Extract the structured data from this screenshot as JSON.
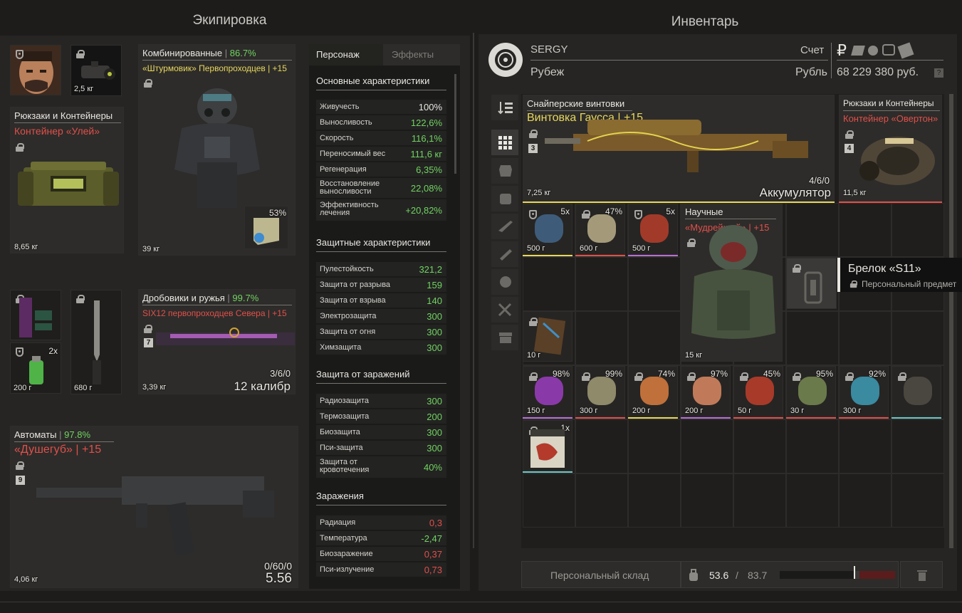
{
  "equipment": {
    "title": "Экипировка",
    "binocular_weight": "2,5 кг",
    "backpack": {
      "category": "Рюкзаки и Контейнеры",
      "name": "Контейнер «Улей»",
      "weight": "8,65 кг"
    },
    "armor": {
      "category": "Комбинированные",
      "durability": "86.7%",
      "name": "«Штурмовик» Первопроходцев | +15",
      "plate_pct": "53%",
      "weight": "39 кг"
    },
    "grenade": {
      "count": "2x",
      "weight": "200 г"
    },
    "knife": {
      "weight": "680 г"
    },
    "shotgun": {
      "category": "Дробовики и ружья",
      "durability": "99.7%",
      "name": "SIX12 первопроходцев Севера | +15",
      "badge": "7",
      "ammo": "3/6/0",
      "caliber": "12 калибр",
      "weight": "3,39 кг"
    },
    "rifle": {
      "category": "Автоматы",
      "durability": "97.8%",
      "name": "«Душегуб» | +15",
      "badge": "9",
      "ammo": "0/60/0",
      "caliber": "5.56",
      "weight": "4,06 кг"
    }
  },
  "stats": {
    "tabs": [
      "Персонаж",
      "Эффекты"
    ],
    "sections": [
      {
        "title": "Основные характеристики",
        "rows": [
          {
            "label": "Живучесть",
            "value": "100%",
            "color": "#e9e7e2"
          },
          {
            "label": "Выносливость",
            "value": "122,6%",
            "color": "#71d361"
          },
          {
            "label": "Скорость",
            "value": "116,1%",
            "color": "#71d361"
          },
          {
            "label": "Переносимый вес",
            "value": "111,6 кг",
            "color": "#71d361"
          },
          {
            "label": "Регенерация",
            "value": "6,35%",
            "color": "#71d361"
          },
          {
            "label": "Восстановление выносливости",
            "value": "22,08%",
            "color": "#71d361"
          },
          {
            "label": "Эффективность лечения",
            "value": "+20,82%",
            "color": "#71d361"
          }
        ]
      },
      {
        "title": "Защитные характеристики",
        "rows": [
          {
            "label": "Пулестойкость",
            "value": "321,2",
            "color": "#71d361"
          },
          {
            "label": "Защита от разрыва",
            "value": "159",
            "color": "#71d361"
          },
          {
            "label": "Защита от взрыва",
            "value": "140",
            "color": "#71d361"
          },
          {
            "label": "Электрозащита",
            "value": "300",
            "color": "#71d361"
          },
          {
            "label": "Защита от огня",
            "value": "300",
            "color": "#71d361"
          },
          {
            "label": "Химзащита",
            "value": "300",
            "color": "#71d361"
          }
        ]
      },
      {
        "title": "Защита от заражений",
        "rows": [
          {
            "label": "Радиозащита",
            "value": "300",
            "color": "#71d361"
          },
          {
            "label": "Термозащита",
            "value": "200",
            "color": "#71d361"
          },
          {
            "label": "Биозащита",
            "value": "300",
            "color": "#71d361"
          },
          {
            "label": "Пси-защита",
            "value": "300",
            "color": "#71d361"
          },
          {
            "label": "Защита от кровотечения",
            "value": "40%",
            "color": "#71d361"
          }
        ]
      },
      {
        "title": "Заражения",
        "rows": [
          {
            "label": "Радиация",
            "value": "0,3",
            "color": "#e0504b"
          },
          {
            "label": "Температура",
            "value": "-2,47",
            "color": "#71d361"
          },
          {
            "label": "Биозаражение",
            "value": "0,37",
            "color": "#e0504b"
          },
          {
            "label": "Пси-излучение",
            "value": "0,73",
            "color": "#e0504b"
          }
        ]
      }
    ]
  },
  "inventory": {
    "title": "Инвентарь",
    "player": "SERGY",
    "server": "Рубеж",
    "account_label": "Счет",
    "currency_label": "Рубль",
    "balance": "68 229 380 руб.",
    "help": "?",
    "sniper": {
      "category": "Снайперские винтовки",
      "name": "Винтовка Гаусса | +15",
      "badge": "3",
      "ammo": "4/6/0",
      "caliber": "Аккумулятор",
      "weight": "7,25 кг"
    },
    "container": {
      "category": "Рюкзаки и Контейнеры",
      "name": "Контейнер «Овертон»",
      "badge": "4",
      "weight": "11,5 кг"
    },
    "sci_armor": {
      "category": "Научные",
      "name": "«Мудрейший» | +15",
      "weight": "15 кг"
    },
    "items_row1": [
      {
        "count": "5x",
        "weight": "500 г",
        "line": "#e8d75c"
      },
      {
        "pct": "47%",
        "weight": "600 г",
        "line": "#e0504b"
      },
      {
        "count": "5x",
        "weight": "500 г",
        "line": "#b86fd6"
      }
    ],
    "item_map": {
      "weight": "10 г"
    },
    "items_row4": [
      {
        "pct": "98%",
        "weight": "150 г",
        "line": "#b86fd6"
      },
      {
        "pct": "99%",
        "weight": "300 г",
        "line": "#e0504b"
      },
      {
        "pct": "74%",
        "weight": "200 г",
        "line": "#e8d75c"
      },
      {
        "pct": "97%",
        "weight": "200 г",
        "line": "#b86fd6"
      },
      {
        "pct": "45%",
        "weight": "50 г",
        "line": "#e0504b"
      },
      {
        "pct": "95%",
        "weight": "30 г",
        "line": "#e0504b"
      },
      {
        "pct": "92%",
        "weight": "300 г",
        "line": "#e0504b"
      },
      {
        "pct": "",
        "weight": "",
        "line": "#6bc6c6"
      }
    ],
    "item_magazine": {
      "count": "1x"
    },
    "tooltip": {
      "title": "Брелок «S11»",
      "subtitle": "Персональный предмет"
    },
    "stash_button": "Персональный склад",
    "weight_current": "53.6",
    "weight_sep": "/",
    "weight_max": "83.7",
    "weight_fill": 0.64
  }
}
